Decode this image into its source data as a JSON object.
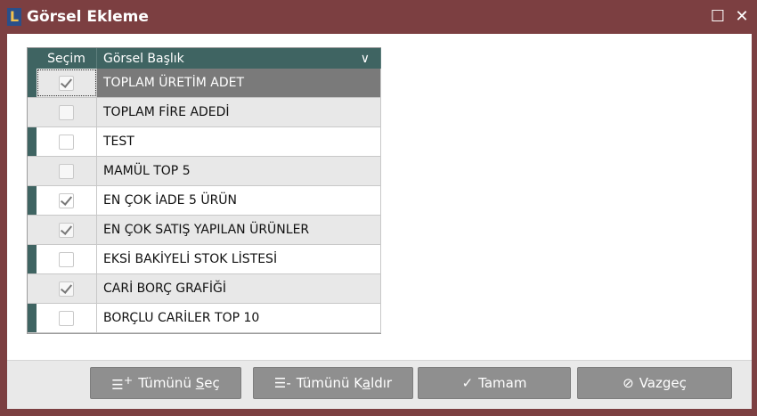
{
  "window": {
    "title": "Görsel Ekleme",
    "app_icon": "L"
  },
  "grid": {
    "columns": [
      "Seçim",
      "Görsel Başlık"
    ],
    "sort_glyph": "∨",
    "rows": [
      {
        "label": "TOPLAM ÜRETİM ADET",
        "checked": true
      },
      {
        "label": "TOPLAM FİRE ADEDİ",
        "checked": false
      },
      {
        "label": "TEST",
        "checked": false
      },
      {
        "label": "MAMÜL TOP 5",
        "checked": false
      },
      {
        "label": "EN ÇOK İADE 5 ÜRÜN",
        "checked": true
      },
      {
        "label": "EN ÇOK SATIŞ YAPILAN ÜRÜNLER",
        "checked": true
      },
      {
        "label": "EKSİ BAKİYELİ STOK LİSTESİ",
        "checked": false
      },
      {
        "label": "CARİ BORÇ GRAFİĞİ",
        "checked": true
      },
      {
        "label": "BORÇLU CARİLER TOP 10",
        "checked": false
      }
    ]
  },
  "buttons": {
    "select_all": {
      "pre": "Tümünü ",
      "key": "S",
      "post": "eç"
    },
    "deselect_all": {
      "pre": "Tümünü K",
      "key": "a",
      "post": "ldır"
    },
    "ok": "Tamam",
    "cancel": "Vazgeç"
  }
}
